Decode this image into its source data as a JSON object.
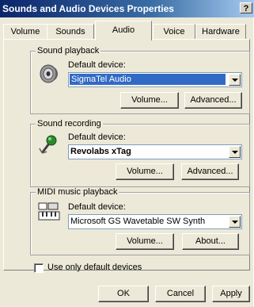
{
  "window": {
    "title": "Sounds and Audio Devices Properties",
    "help_label": "?"
  },
  "tabs": [
    {
      "label": "Volume"
    },
    {
      "label": "Sounds"
    },
    {
      "label": "Audio"
    },
    {
      "label": "Voice"
    },
    {
      "label": "Hardware"
    }
  ],
  "playback": {
    "group_label": "Sound playback",
    "default_label": "Default device:",
    "device": "SigmaTel Audio",
    "volume_button": "Volume...",
    "advanced_button": "Advanced..."
  },
  "recording": {
    "group_label": "Sound recording",
    "default_label": "Default device:",
    "device": "Revolabs xTag",
    "volume_button": "Volume...",
    "advanced_button": "Advanced..."
  },
  "midi": {
    "group_label": "MIDI music playback",
    "default_label": "Default device:",
    "device": "Microsoft GS Wavetable SW Synth",
    "volume_button": "Volume...",
    "about_button": "About..."
  },
  "options": {
    "use_default_only_label": "Use only default devices"
  },
  "footer": {
    "ok_label": "OK",
    "cancel_label": "Cancel",
    "apply_label": "Apply"
  }
}
